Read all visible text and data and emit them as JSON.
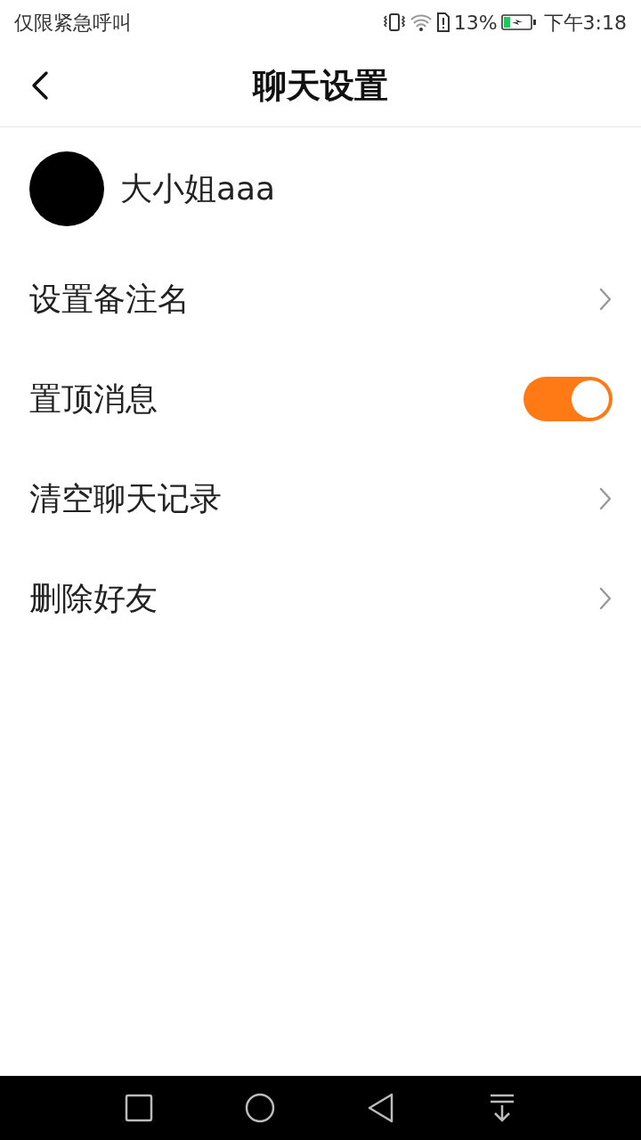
{
  "status_bar": {
    "carrier": "仅限紧急呼叫",
    "battery_text": "13%",
    "time": "下午3:18"
  },
  "header": {
    "title": "聊天设置"
  },
  "profile": {
    "name": "大小姐aaa"
  },
  "items": [
    {
      "kind": "link",
      "label": "设置备注名"
    },
    {
      "kind": "toggle",
      "label": "置顶消息",
      "on": true
    },
    {
      "kind": "link",
      "label": "清空聊天记录"
    },
    {
      "kind": "link",
      "label": "删除好友"
    }
  ]
}
